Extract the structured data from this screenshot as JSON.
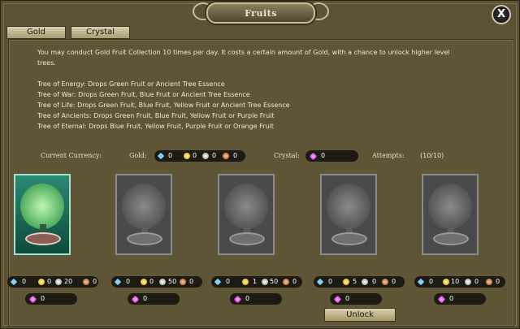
{
  "window": {
    "title": "Fruits",
    "close_label": "X"
  },
  "tabs": [
    {
      "label": "Gold"
    },
    {
      "label": "Crystal"
    }
  ],
  "description": {
    "intro_line1": "You may conduct Gold Fruit Collection 10 times per day. It costs a certain amount of Gold, with a chance to unlock higher level",
    "intro_line2": "trees.",
    "trees": [
      "Tree of Energy: Drops Green Fruit or Ancient Tree Essence",
      "Tree of War: Drops Green Fruit, Blue Fruit or Ancient Tree Essence",
      "Tree of Life: Drops Green Fruit, Blue Fruit, Yellow Fruit or Ancient Tree Essence",
      "Tree of Ancients: Drops Green Fruit, Blue Fruit, Yellow Fruit or Purple Fruit",
      "Tree of Eternal: Drops Blue Fruit, Yellow Fruit, Purple Fruit or Orange Fruit"
    ]
  },
  "currency": {
    "current_label": "Current Currency:",
    "gold_label": "Gold:",
    "gold": {
      "diamond": "0",
      "gold": "0",
      "silver": "0",
      "copper": "0"
    },
    "crystal_label": "Crystal:",
    "crystal": "0",
    "attempts_label": "Attempts:",
    "attempts": "(10/10)"
  },
  "cards": [
    {
      "name": "Tree of Energy",
      "active": true,
      "cost": {
        "diamond": "0",
        "gold": "0",
        "silver": "20",
        "copper": "0"
      },
      "crystal": "0"
    },
    {
      "name": "Tree of War",
      "active": false,
      "cost": {
        "diamond": "0",
        "gold": "0",
        "silver": "50",
        "copper": "0"
      },
      "crystal": "0"
    },
    {
      "name": "Tree of Life",
      "active": false,
      "cost": {
        "diamond": "0",
        "gold": "1",
        "silver": "50",
        "copper": "0"
      },
      "crystal": "0"
    },
    {
      "name": "Tree of Ancients",
      "active": false,
      "cost": {
        "diamond": "0",
        "gold": "5",
        "silver": "0",
        "copper": "0"
      },
      "crystal": "0"
    },
    {
      "name": "Tree of Eternal",
      "active": false,
      "cost": {
        "diamond": "0",
        "gold": "10",
        "silver": "0",
        "copper": "0"
      },
      "crystal": "0"
    }
  ],
  "unlock_label": "Unlock",
  "icons": [
    "diamond-icon",
    "gold-coin-icon",
    "silver-coin-icon",
    "copper-coin-icon",
    "crystal-gem-icon",
    "close-icon"
  ]
}
